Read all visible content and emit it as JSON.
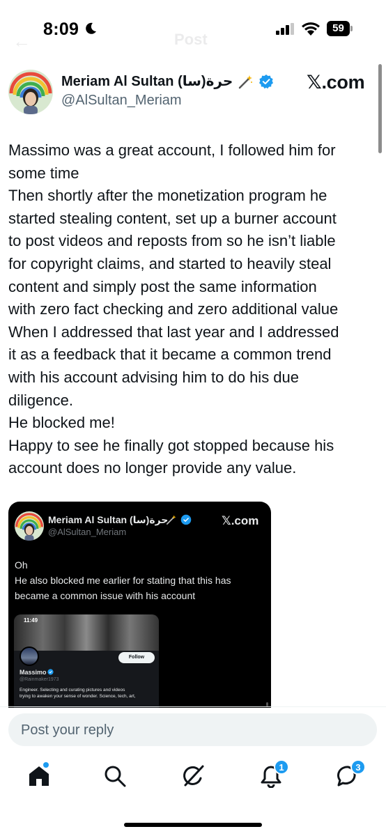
{
  "status_bar": {
    "time": "8:09",
    "battery": "59",
    "icons": [
      "moon-icon",
      "signal-icon",
      "wifi-icon",
      "battery-icon"
    ]
  },
  "ghost_header": {
    "back": "←",
    "title": "Post"
  },
  "tweet": {
    "author_name": "Meriam Al Sultan (سا)حرة",
    "author_handle": "@AlSultan_Meriam",
    "brand": "𝕏.com",
    "lines": [
      "Massimo was a great account, I followed him for",
      "some time",
      "Then shortly after the monetization program he",
      "started stealing content, set up a burner account",
      "to post videos and reposts from so he isn’t liable",
      "for copyright claims, and started to heavily steal",
      "content and simply post the same information",
      "with zero fact checking and zero additional value",
      "When I addressed that last year and I addressed",
      "it as a feedback that it became a common trend",
      "with his account advising him to do his due",
      "diligence.",
      "He blocked me!",
      "Happy to see he finally got stopped because his",
      "account does no longer provide any value."
    ]
  },
  "embed": {
    "author_name": "Meriam Al Sultan (سا)حرة",
    "author_handle": "@AlSultan_Meriam",
    "brand": "𝕏.com",
    "lines": [
      "Oh",
      "He also blocked me earlier for stating that this has",
      "became a common issue with his account"
    ],
    "inner": {
      "time": "11:49",
      "follow_label": "Follow",
      "profile_name": "Massimo",
      "profile_handle": "@Rainmaker1973",
      "bio_lines": [
        "Engineer. Selecting and curating pictures and videos",
        "trying to awaken your sense of wonder. Science, tech, art,"
      ]
    }
  },
  "reply": {
    "placeholder": "Post your reply"
  },
  "nav": {
    "notifications_badge": "1",
    "messages_badge": "3",
    "accent": "#1d9bf0"
  }
}
